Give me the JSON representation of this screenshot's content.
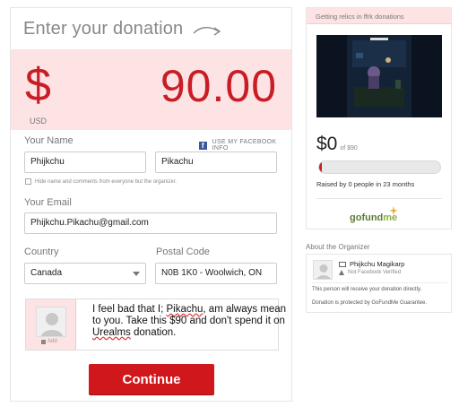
{
  "donation": {
    "title": "Enter your donation",
    "currency_symbol": "$",
    "currency_code": "USD",
    "amount": "90.00"
  },
  "form": {
    "name_label": "Your Name",
    "facebook_link": "USE MY FACEBOOK INFO",
    "first_name": "Phijkchu",
    "last_name": "Pikachu",
    "hide_label": "Hide name and comments from everyone but the organizer.",
    "email_label": "Your Email",
    "email": "Phijkchu.Pikachu@gmail.com",
    "country_label": "Country",
    "country": "Canada",
    "postal_label": "Postal Code",
    "postal_code": "N0B 1K0 - Woolwich, ON",
    "comment_pre": "I feel bad that I; ",
    "comment_name": "Pikachu",
    "comment_mid": ", am always mean to you. Take this $90 and don't spend it on ",
    "comment_word": "Urealms",
    "comment_post": " donation.",
    "photo_add_label": "Add",
    "continue_label": "Continue"
  },
  "campaign": {
    "header": "Getting relics in ffrk donations",
    "raised": "$0",
    "goal_text": "of $90",
    "progress_fraction": 0.02,
    "raised_by_pre": "Raised by ",
    "raised_by_people": "0",
    "raised_by_mid": " people in ",
    "raised_by_months": "23",
    "raised_by_post": " months",
    "logo_go": "gofund",
    "logo_me": "me"
  },
  "organizer": {
    "section_title": "About the Organizer",
    "name": "Phijkchu Magikarp",
    "verified": "Not Facebook Verified",
    "note1": "This person will receive your donation directly.",
    "note2": "Donation is protected by GoFundMe Guarantee."
  },
  "colors": {
    "accent": "#c81d25",
    "amount_bg": "#fde3e3",
    "logo_green": "#5c7a33"
  }
}
